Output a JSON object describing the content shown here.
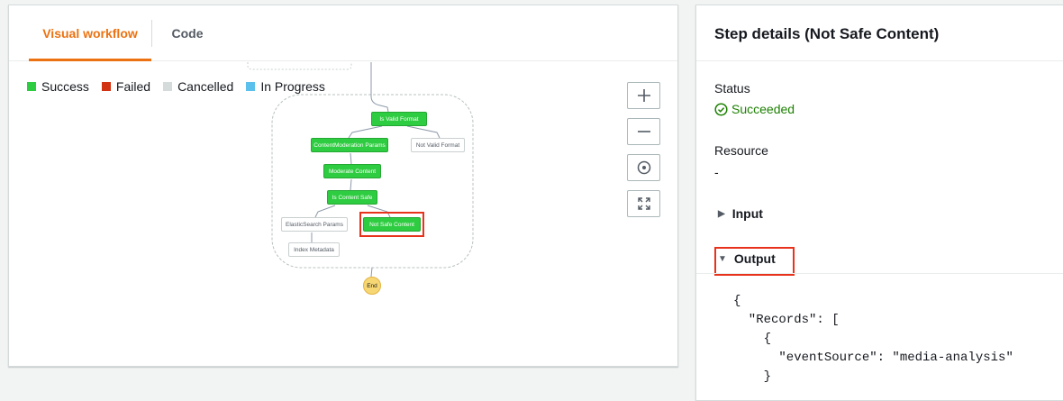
{
  "tabs": {
    "visual": "Visual workflow",
    "code": "Code"
  },
  "legend": [
    {
      "label": "Success",
      "color": "#2ecc40"
    },
    {
      "label": "Failed",
      "color": "#d13212"
    },
    {
      "label": "Cancelled",
      "color": "#d5dbdb"
    },
    {
      "label": "In Progress",
      "color": "#5bc0eb"
    }
  ],
  "controls": {
    "zoom_in": "+",
    "zoom_out": "−"
  },
  "workflow": {
    "nodes": {
      "is_valid_format": "Is Valid Format",
      "content_moderation_params": "ContentModeration Params",
      "not_valid_format": "Not Valid Format",
      "moderate_content": "Moderate Content",
      "is_content_safe": "Is Content Safe",
      "elasticsearch_params": "ElasticSearch Params",
      "not_safe_content": "Not Safe Content",
      "index_metadata": "Index Metadata",
      "end": "End"
    }
  },
  "details": {
    "title": "Step details (Not Safe Content)",
    "status_label": "Status",
    "status_value": "Succeeded",
    "resource_label": "Resource",
    "resource_value": "-",
    "input_label": "Input",
    "output_label": "Output",
    "output_code": "{\n  \"Records\": [\n    {\n      \"eventSource\": \"media-analysis\"\n    }"
  },
  "colors": {
    "accent": "#ec7211",
    "success": "#1d8102",
    "highlight": "#e8331c"
  }
}
